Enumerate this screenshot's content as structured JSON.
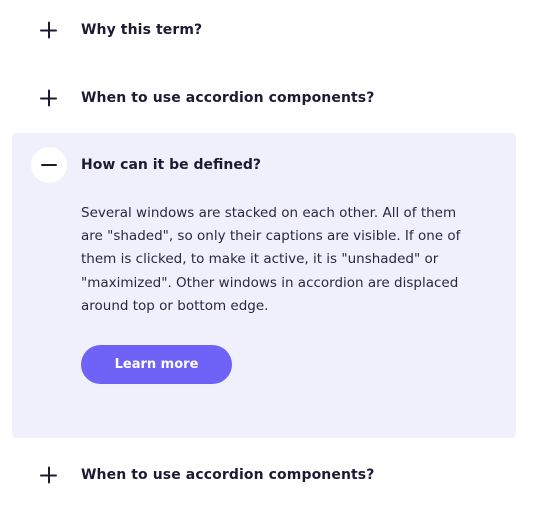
{
  "accordion": {
    "items": [
      {
        "title": "Why this term?",
        "expanded": false,
        "icon": "plus-icon"
      },
      {
        "title": "When to use accordion components?",
        "expanded": false,
        "icon": "plus-icon"
      },
      {
        "title": "How can it be defined?",
        "expanded": true,
        "icon": "minus-icon",
        "body": "Several windows are stacked on each other. All of them are \"shaded\", so only their captions are visible. If one of them is clicked, to make it active, it is \"unshaded\" or \"maximized\". Other windows in accordion are displaced around top or bottom edge.",
        "button_label": "Learn more"
      },
      {
        "title": "When to use accordion components?",
        "expanded": false,
        "icon": "plus-icon"
      }
    ]
  },
  "colors": {
    "panel_background": "#eff0fc",
    "accent": "#6e63f6",
    "text": "#1d1b33"
  }
}
